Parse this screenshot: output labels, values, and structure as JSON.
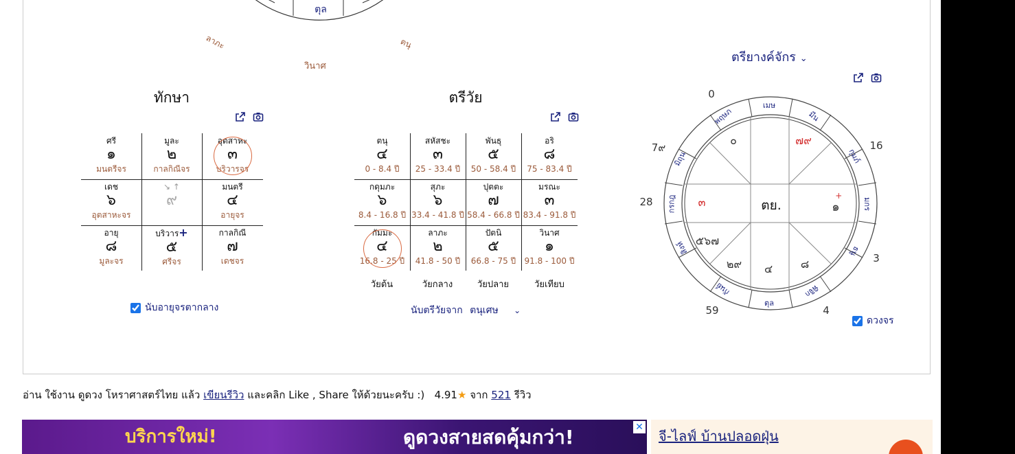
{
  "top_chart": {
    "bottom_label": "ตุล",
    "labels": [
      "ลาภะ",
      "ตนุ",
      "วินาศ"
    ]
  },
  "thaksa": {
    "title": "ทักษา",
    "cells": [
      {
        "label": "ศรี",
        "num": "๑",
        "sub": "มนตรีจร"
      },
      {
        "label": "มูละ",
        "num": "๒",
        "sub": "กาลกิณีจร"
      },
      {
        "label": "อุตสาหะ",
        "num": "๓",
        "sub": "บริวารจร"
      },
      {
        "label": "เดช",
        "num": "๖",
        "sub": "อุตสาหะจร"
      },
      {
        "label": "",
        "num": "๙",
        "sub": ""
      },
      {
        "label": "มนตรี",
        "num": "๔",
        "sub": "อายุจร"
      },
      {
        "label": "อายุ",
        "num": "๘",
        "sub": "มูละจร"
      },
      {
        "label": "บริวาร",
        "num": "๕",
        "sub": "ศรีจร"
      },
      {
        "label": "กาลกิณี",
        "num": "๗",
        "sub": "เดชจร"
      }
    ],
    "checkbox_label": "นับอายุจรตากลาง"
  },
  "triwai": {
    "title": "ตรีวัย",
    "cells": [
      {
        "label": "ตนุ",
        "num": "๔",
        "sub": "0 - 8.4 ปี"
      },
      {
        "label": "สหัสชะ",
        "num": "๓",
        "sub": "25 - 33.4 ปี"
      },
      {
        "label": "พันธุ",
        "num": "๕",
        "sub": "50 - 58.4 ปี"
      },
      {
        "label": "อริ",
        "num": "๘",
        "sub": "75 - 83.4 ปี"
      },
      {
        "label": "กดุมภะ",
        "num": "๖",
        "sub": "8.4 - 16.8 ปี"
      },
      {
        "label": "สุภะ",
        "num": "๖",
        "sub": "33.4 - 41.8 ปี"
      },
      {
        "label": "ปุตตะ",
        "num": "๗",
        "sub": "58.4 - 66.8 ปี"
      },
      {
        "label": "มรณะ",
        "num": "๓",
        "sub": "83.4 - 91.8 ปี"
      },
      {
        "label": "กัมมะ",
        "num": "๔",
        "sub": "16.8 - 25 ปี"
      },
      {
        "label": "ลาภะ",
        "num": "๒",
        "sub": "41.8 - 50 ปี"
      },
      {
        "label": "ปัตนิ",
        "num": "๕",
        "sub": "66.8 - 75 ปี"
      },
      {
        "label": "วินาศ",
        "num": "๑",
        "sub": "91.8 - 100 ปี"
      }
    ],
    "age_labels": [
      "วัยต้น",
      "วัยกลาง",
      "วัยปลาย",
      "วัยเทียบ"
    ],
    "count_label": "นับตรีวัยจาก",
    "count_value": "ตนุเศษ"
  },
  "triyang": {
    "title": "ตรียางค์จักร",
    "outer_numbers": [
      "0",
      "16",
      "3",
      "4",
      "59",
      "28",
      "7๙"
    ],
    "signs": [
      "เมษ",
      "มีน",
      "กุมภ์",
      "มกร",
      "ธนู",
      "พิจิก",
      "ตุล",
      "กันย์",
      "สิงห์",
      "กรกฎ",
      "มิถุน",
      "พฤษภ"
    ],
    "center": "ตย.",
    "houses": [
      "๐",
      "๗๙",
      "๓",
      "๑",
      "๕๖๗",
      "๒๙",
      "๔",
      "๘"
    ],
    "checkbox_label": "ดวงจร"
  },
  "rating": {
    "prefix": "อ่าน ใช้งาน ดูดวง โหราศาสตร์ไทย แล้ว",
    "review_link": "เขียนรีวิว",
    "middle": "และคลิก Like , Share ให้ด้วยนะครับ :)",
    "score": "4.91",
    "from": "จาก",
    "count": "521",
    "suffix": "รีวิว"
  },
  "ads": {
    "left_text1": "บริการใหม่!",
    "left_text2": "ดูดวงสายสดคุ้มกว่า!",
    "right_title": "จี-ไลฟ์ บ้านปลอดฝุ่น"
  },
  "colors": {
    "accent_navy": "#1a237e",
    "highlight_red": "#d32f2f",
    "circle_orange": "#d9683f"
  }
}
